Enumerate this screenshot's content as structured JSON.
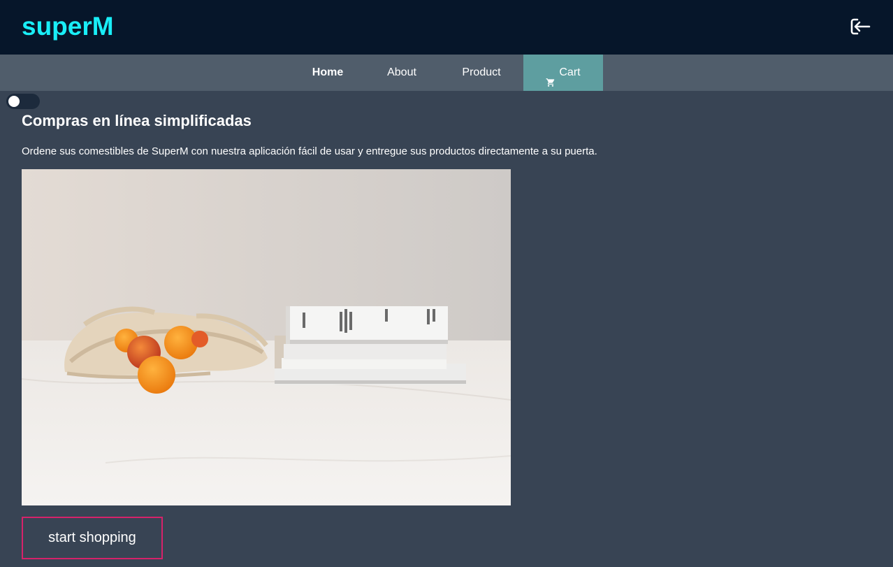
{
  "header": {
    "brand": "superM",
    "logout_icon": "sign-out-icon"
  },
  "nav": {
    "items": [
      {
        "label": "Home",
        "active": true
      },
      {
        "label": "About"
      },
      {
        "label": "Product"
      },
      {
        "label": "Cart",
        "icon": "cart-icon",
        "highlight": true
      }
    ]
  },
  "theme_toggle": {
    "on": false
  },
  "main": {
    "heading": "Compras en línea simplificadas",
    "description": "Ordene sus comestibles de SuperM con nuestra aplicación fácil de usar y entregue sus productos directamente a su puerta.",
    "button_label": "start shopping"
  },
  "colors": {
    "header_bg": "#06162a",
    "brand": "#19eef7",
    "nav_bg": "#505d6b",
    "cart_bg": "#5e9ea0",
    "page_bg": "#384454",
    "button_border": "#d6226a"
  }
}
